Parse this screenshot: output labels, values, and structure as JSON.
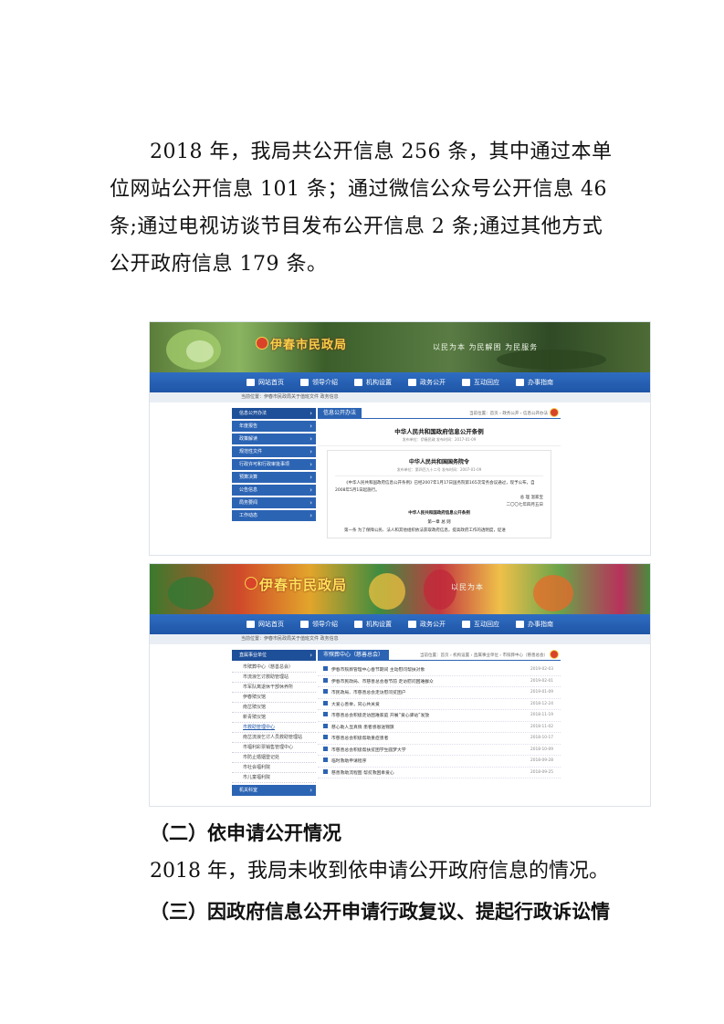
{
  "paragraph_1": "2018 年，我局共公开信息 256 条，其中通过本单位网站公开信息 101 条；通过微信公众号公开信息 46 条;通过电视访谈节目发布公开信息 2 条;通过其他方式公开政府信息 179 条。",
  "screenshot_1": {
    "site_title": "伊春市民政局",
    "slogan": "以民为本 为民解困 为民服务",
    "nav": [
      "网站首页",
      "领导介绍",
      "机构设置",
      "政务公开",
      "互动回应",
      "办事指南"
    ],
    "crumb": "当前位置：伊春市民政局关于值班文件 政务信息",
    "sidebar": [
      "信息公开办法",
      "年度报告",
      "政策解读",
      "规范性文件",
      "行政许可和行政审批事项",
      "预算决算",
      "公告信息",
      "局务要闻",
      "工作动态"
    ],
    "tab": "信息公开办法",
    "location": "当前位置：首页 › 政务公开 › 信息公开办法",
    "doc_title": "中华人民共和国政府信息公开条例",
    "doc_meta": "发布单位：伊春民政  发布时间：2017-01-09",
    "decree_title": "中华人民共和国国务院令",
    "decree_meta": "发布单位：第四百九十二号  发布时间：2007-01-09",
    "decree_body": "《中华人民共和国政府信息公开条例》已经2007年1月17日国务院第165次常务会议通过，现予公布，自2008年5月1日起施行。",
    "sign_1": "总 理  温家宝",
    "sign_2": "二〇〇七年四月五日",
    "reg_title": "中华人民共和国政府信息公开条例",
    "chapter": "第一章 总 则",
    "article_1": "第一条  为了保障公民、法人和其他组织依法获取政府信息，提高政府工作的透明度，促进"
  },
  "screenshot_2": {
    "site_title": "伊春市民政局",
    "slogan": "以民为本",
    "nav": [
      "网站首页",
      "领导介绍",
      "机构设置",
      "政务公开",
      "互动回应",
      "办事指南"
    ],
    "crumb": "当前位置：伊春市民政局关于值班文件 政务信息",
    "sidebar_head": "直属事业单位",
    "sidebar_subs": [
      "市殡葬中心（慈善总会）",
      "市流浪乞讨救助管理站",
      "市军队离退休干部休养所",
      "伊春殡仪馆",
      "南岔殡仪馆",
      "新青殡仪馆",
      "市救助管理中心",
      "南岔流浪乞讨人员救助管理站",
      "市福利彩票销售管理中心",
      "市防止婚姻登记处",
      "市社会福利院",
      "市儿童福利院"
    ],
    "sidebar_selected": 6,
    "sidebar_foot": "机关科室",
    "tab": "市殡葬中心（慈善总会）",
    "location": "当前位置：首页 › 机构设置 › 直属事业单位 › 市殡葬中心（慈善总会）",
    "news": [
      {
        "title": "伊春市殡葬管理中心春节期间 主动慰问帮扶对象",
        "date": "2019-02-03"
      },
      {
        "title": "伊春市民政局、市慈善总会春节前 走访慰问困难群众",
        "date": "2019-02-01"
      },
      {
        "title": "市民政局、市慈善总会走访慰问贫困户",
        "date": "2019-01-09"
      },
      {
        "title": "大爱心善举，同心共关爱",
        "date": "2018-12-24"
      },
      {
        "title": "市慈善总会积极走访困难家庭 开展“爱心驿站”发放",
        "date": "2018-11-19"
      },
      {
        "title": "慈心助人显真情 患者感恩送锦旗",
        "date": "2018-11-02"
      },
      {
        "title": "市慈善总会积极帮助重症患者",
        "date": "2018-10-17"
      },
      {
        "title": "市慈善总会积极帮扶贫困学生圆梦大学",
        "date": "2018-10-09"
      },
      {
        "title": "临时救助申请程序",
        "date": "2018-09-28"
      },
      {
        "title": "慈善救助流程图 帮贫救困奉爱心",
        "date": "2018-09-25"
      }
    ]
  },
  "heading_2": "（二）依申请公开情况",
  "paragraph_2": "2018 年，我局未收到依申请公开政府信息的情况。",
  "heading_3": "（三）因政府信息公开申请行政复议、提起行政诉讼情"
}
